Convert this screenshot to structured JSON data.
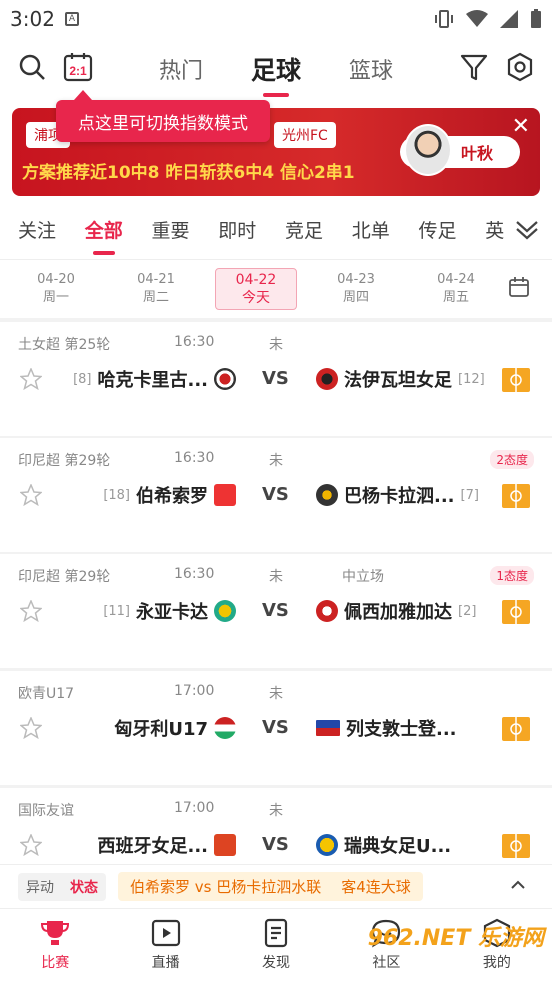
{
  "statusbar": {
    "time": "3:02",
    "note": "A"
  },
  "header": {
    "tabs": [
      "热门",
      "足球",
      "篮球"
    ],
    "index_toggle": "2:1"
  },
  "tooltip": "点这里可切换指数模式",
  "banner": {
    "team_left": "浦项",
    "team_right": "光州FC",
    "promo": "方案推荐近10中8 昨日斩获6中4 信心2串1",
    "expert": "叶秋"
  },
  "categories": [
    "关注",
    "全部",
    "重要",
    "即时",
    "竞足",
    "北单",
    "传足",
    "英"
  ],
  "dates": [
    {
      "date": "04-20",
      "day": "周一"
    },
    {
      "date": "04-21",
      "day": "周二"
    },
    {
      "date": "04-22",
      "day": "今天"
    },
    {
      "date": "04-23",
      "day": "周四"
    },
    {
      "date": "04-24",
      "day": "周五"
    }
  ],
  "matches": [
    {
      "league": "土女超 第25轮",
      "time": "16:30",
      "status": "未",
      "venue": "",
      "badge": "",
      "home": "哈克卡里古...",
      "home_rank": "[8]",
      "away": "法伊瓦坦女足",
      "away_rank": "[12]",
      "vs": "VS"
    },
    {
      "league": "印尼超 第29轮",
      "time": "16:30",
      "status": "未",
      "venue": "",
      "badge": "2态度",
      "home": "伯希索罗",
      "home_rank": "[18]",
      "away": "巴杨卡拉泗...",
      "away_rank": "[7]",
      "vs": "VS"
    },
    {
      "league": "印尼超 第29轮",
      "time": "16:30",
      "status": "未",
      "venue": "中立场",
      "badge": "1态度",
      "home": "永亚卡达",
      "home_rank": "[11]",
      "away": "佩西加雅加达",
      "away_rank": "[2]",
      "vs": "VS"
    },
    {
      "league": "欧青U17",
      "time": "17:00",
      "status": "未",
      "venue": "",
      "badge": "",
      "home": "匈牙利U17",
      "home_rank": "",
      "away": "列支敦士登...",
      "away_rank": "",
      "vs": "VS"
    },
    {
      "league": "国际友谊",
      "time": "17:00",
      "status": "未",
      "venue": "",
      "badge": "",
      "home": "西班牙女足...",
      "home_rank": "",
      "away": "瑞典女足U...",
      "away_rank": "",
      "vs": "VS"
    }
  ],
  "ticker": {
    "tab_a": "异动",
    "tab_b": "状态",
    "match": "伯希索罗 vs 巴杨卡拉泗水联",
    "info": "客4连大球"
  },
  "nav": [
    "比赛",
    "直播",
    "发现",
    "社区",
    "我的"
  ],
  "watermark": "962.NET 乐游网",
  "colors": {
    "accent": "#e8264c",
    "banner": "#c7141f",
    "field": "#f5a623"
  }
}
